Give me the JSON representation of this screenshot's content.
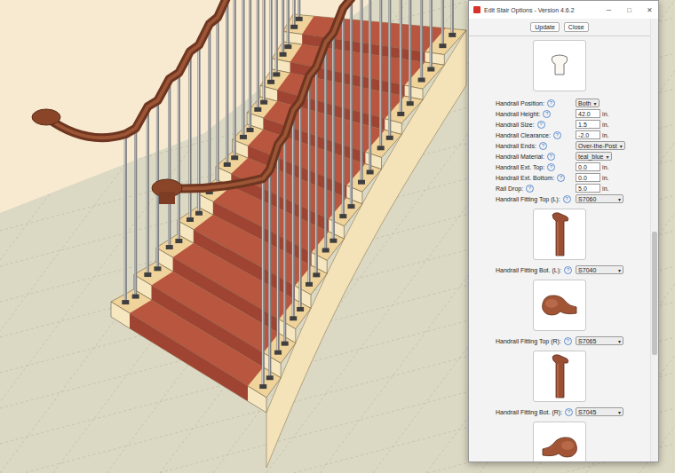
{
  "window": {
    "title": "Edit Stair Options - Version 4.6.2",
    "controls": [
      "─",
      "□",
      "✕"
    ]
  },
  "buttons": [
    "Update",
    "Close"
  ],
  "select_caret": "▾",
  "fields": [
    {
      "label": "Handrail Position:",
      "help": "?",
      "kind": "select",
      "value": "Both"
    },
    {
      "label": "Handrail Height:",
      "help": "?",
      "kind": "input",
      "value": "42.0",
      "unit": "in."
    },
    {
      "label": "Handrail Size:",
      "help": "?",
      "kind": "input",
      "value": "1.5",
      "unit": "in."
    },
    {
      "label": "Handrail Clearance:",
      "help": "?",
      "kind": "input",
      "value": "-2.0",
      "unit": "in."
    },
    {
      "label": "Handrail Ends:",
      "help": "?",
      "kind": "select",
      "value": "Over-the-Post"
    },
    {
      "label": "Handrail Material:",
      "help": "?",
      "kind": "select",
      "value": "teal_blue"
    },
    {
      "label": "Handrail Ext. Top:",
      "help": "?",
      "kind": "input",
      "value": "0.0",
      "unit": "in."
    },
    {
      "label": "Handrail Ext. Bottom:",
      "help": "?",
      "kind": "input",
      "value": "0.0",
      "unit": "in."
    },
    {
      "label": "Rail Drop:",
      "help": "?",
      "kind": "input",
      "value": "5.0",
      "unit": "in."
    },
    {
      "label": "Handrail Fitting Top (L):",
      "help": "?",
      "kind": "fitting-post",
      "value": "S7060"
    },
    {
      "label": "Handrail Fitting Bot. (L):",
      "help": "?",
      "kind": "fitting-turnout",
      "value": "S7040"
    },
    {
      "label": "Handrail Fitting Top (R):",
      "help": "?",
      "kind": "fitting-post",
      "value": "S7065"
    },
    {
      "label": "Handrail Fitting Bot. (R):",
      "help": "?",
      "kind": "fitting-turnout",
      "value": "S7045"
    }
  ],
  "scrollbar": {
    "level": 0.48
  }
}
